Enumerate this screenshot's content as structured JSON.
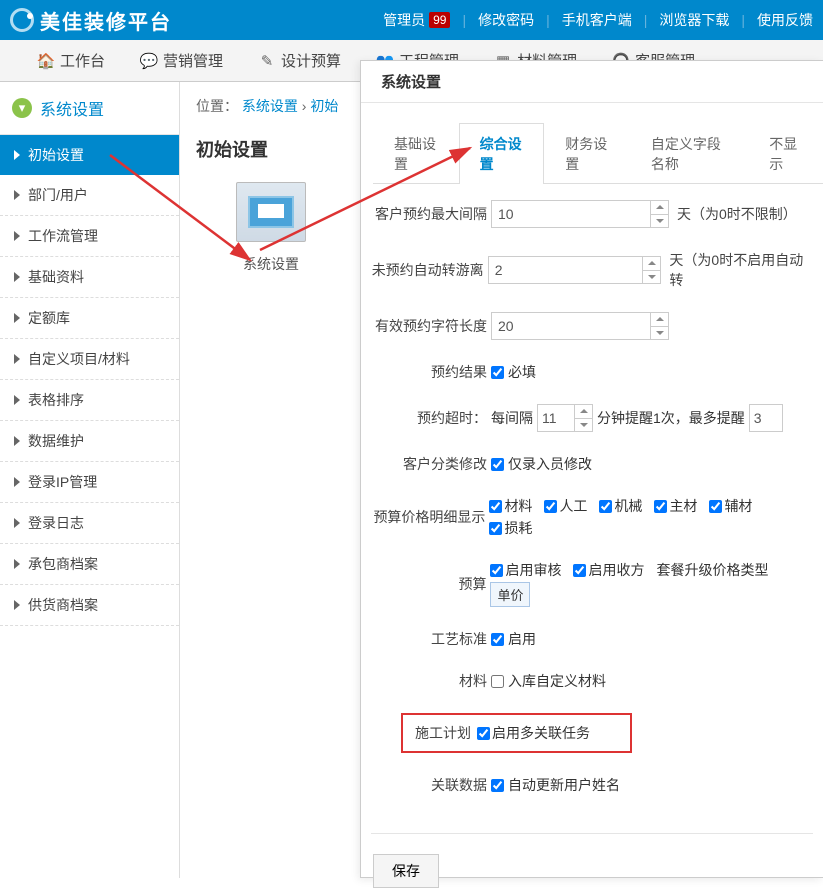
{
  "header": {
    "logo": "美佳装修平台",
    "links": {
      "admin": "管理员",
      "badge": "99",
      "password": "修改密码",
      "mobile": "手机客户端",
      "browser": "浏览器下载",
      "feedback": "使用反馈"
    }
  },
  "nav": {
    "workbench": "工作台",
    "marketing": "营销管理",
    "design": "设计预算",
    "engineering": "工程管理",
    "material": "材料管理",
    "service": "客服管理"
  },
  "sidebar": {
    "title": "系统设置",
    "items": [
      "初始设置",
      "部门/用户",
      "工作流管理",
      "基础资料",
      "定额库",
      "自定义项目/材料",
      "表格排序",
      "数据维护",
      "登录IP管理",
      "登录日志",
      "承包商档案",
      "供货商档案"
    ]
  },
  "breadcrumb": {
    "loc": "位置：",
    "lvl1": "系统设置",
    "lvl2": "初始"
  },
  "content": {
    "title": "初始设置",
    "module_label": "系统设置"
  },
  "popup": {
    "title": "系统设置",
    "tabs": [
      "基础设置",
      "综合设置",
      "财务设置",
      "自定义字段名称",
      "不显示"
    ],
    "form": {
      "row1_label": "客户预约最大间隔",
      "row1_value": "10",
      "row1_after": "天（为0时不限制）",
      "row2_label": "未预约自动转游离",
      "row2_value": "2",
      "row2_after": "天（为0时不启用自动转",
      "row3_label": "有效预约字符长度",
      "row3_value": "20",
      "row4_label": "预约结果",
      "row4_chk": "必填",
      "row5_label": "预约超时：",
      "row5_mid1": "每间隔",
      "row5_val1": "11",
      "row5_mid2": "分钟提醒1次，最多提醒",
      "row5_val2": "3",
      "row6_label": "客户分类修改",
      "row6_chk": "仅录入员修改",
      "row7_label": "预算价格明细显示",
      "row7_chks": [
        "材料",
        "人工",
        "机械",
        "主材",
        "辅材",
        "损耗"
      ],
      "row8_label": "预算",
      "row8_chk1": "启用审核",
      "row8_chk2": "启用收方",
      "row8_text": "套餐升级价格类型",
      "row8_tag": "单价",
      "row9_label": "工艺标准",
      "row9_chk": "启用",
      "row10_label": "材料",
      "row10_chk": "入库自定义材料",
      "row11_label": "施工计划",
      "row11_chk": "启用多关联任务",
      "row12_label": "关联数据",
      "row12_chk": "自动更新用户姓名",
      "save": "保存"
    }
  }
}
